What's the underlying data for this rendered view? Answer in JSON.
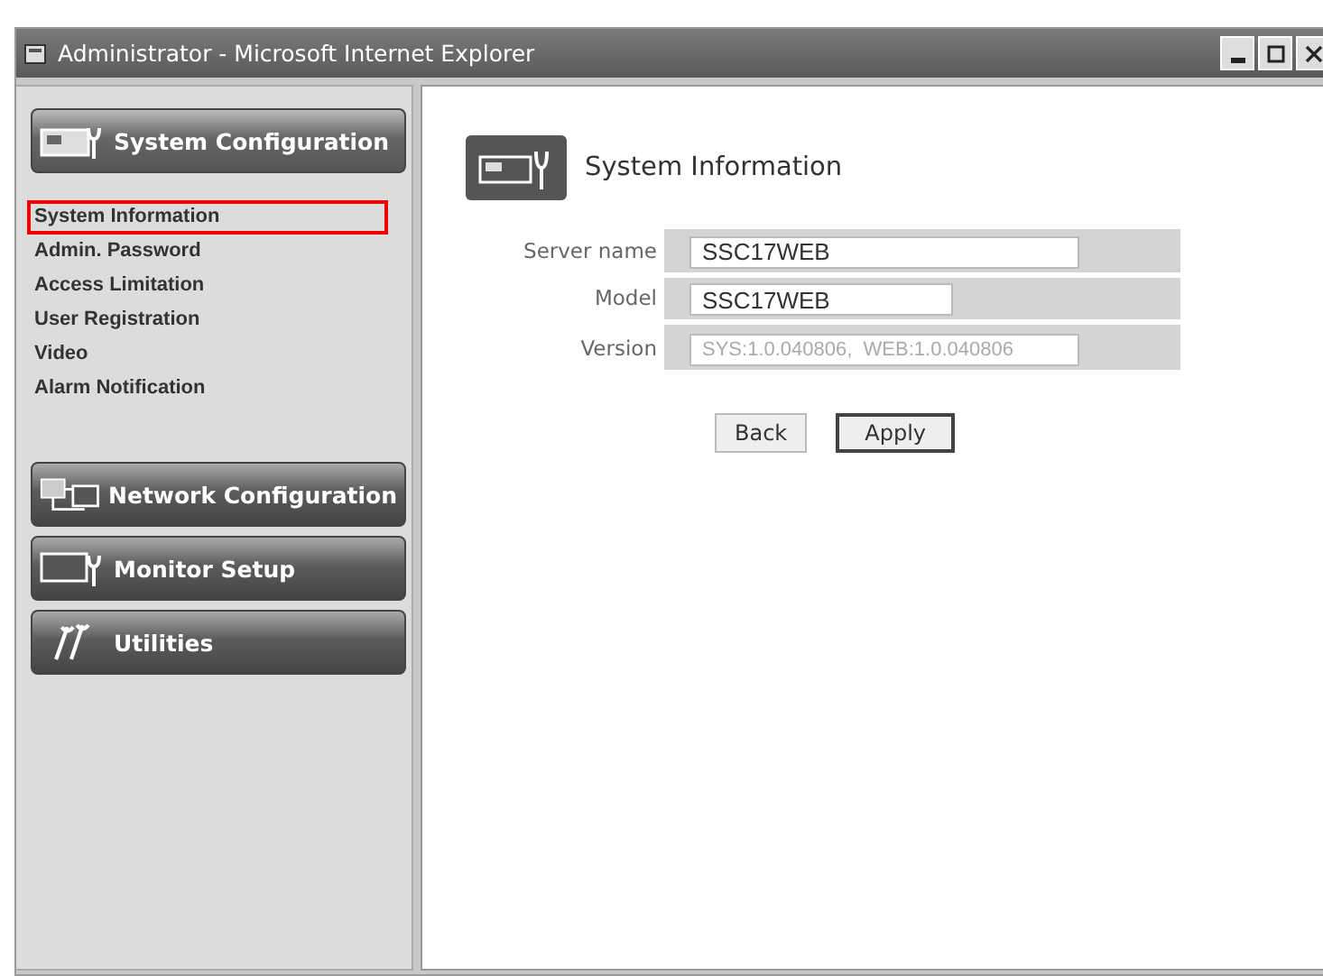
{
  "window": {
    "title": "Administrator - Microsoft Internet Explorer"
  },
  "sidebar": {
    "sections": [
      {
        "label": "System Configuration",
        "kind": "device",
        "expanded": true,
        "items": [
          {
            "label": "System Information",
            "selected": true
          },
          {
            "label": "Admin. Password",
            "selected": false
          },
          {
            "label": "Access Limitation",
            "selected": false
          },
          {
            "label": "User Registration",
            "selected": false
          },
          {
            "label": "Video",
            "selected": false
          },
          {
            "label": "Alarm Notification",
            "selected": false
          }
        ]
      },
      {
        "label": "Network Configuration",
        "kind": "network",
        "expanded": false
      },
      {
        "label": "Monitor Setup",
        "kind": "monitor",
        "expanded": false
      },
      {
        "label": "Utilities",
        "kind": "tools",
        "expanded": false
      }
    ]
  },
  "content": {
    "title": "System Information",
    "fields": [
      {
        "label": "Server name",
        "value": "SSC17WEB",
        "kind": "long",
        "disabled": false
      },
      {
        "label": "Model",
        "value": "SSC17WEB",
        "kind": "short",
        "disabled": false
      },
      {
        "label": "Version",
        "value": "SYS:1.0.040806,  WEB:1.0.040806",
        "kind": "long",
        "disabled": true
      }
    ],
    "buttons": [
      {
        "label": "Back",
        "default": false
      },
      {
        "label": "Apply",
        "default": true
      }
    ]
  }
}
